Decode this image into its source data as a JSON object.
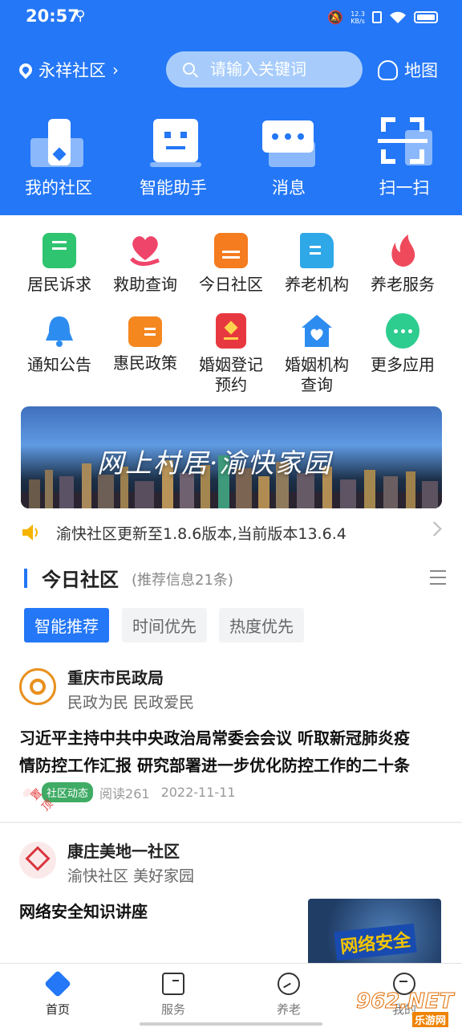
{
  "status": {
    "time": "20:57",
    "speed_value": "12.3",
    "speed_unit": "KB/s"
  },
  "topbar": {
    "location": "永祥社区",
    "search_placeholder": "请输入关键词",
    "map_label": "地图"
  },
  "quick_actions": [
    {
      "label": "我的社区",
      "icon": "community-icon"
    },
    {
      "label": "智能助手",
      "icon": "robot-icon"
    },
    {
      "label": "消息",
      "icon": "message-icon"
    },
    {
      "label": "扫一扫",
      "icon": "scan-icon"
    }
  ],
  "grid": [
    {
      "label": "居民诉求",
      "icon": "petition-icon",
      "color": "#2fc46f"
    },
    {
      "label": "救助查询",
      "icon": "heart-hand-icon",
      "color": "#f0456a"
    },
    {
      "label": "今日社区",
      "icon": "news-icon",
      "color": "#f57c1f"
    },
    {
      "label": "养老机构",
      "icon": "building-doc-icon",
      "color": "#2fa8e8"
    },
    {
      "label": "养老服务",
      "icon": "flame-icon",
      "color": "#ef4a5c"
    },
    {
      "label": "通知公告",
      "icon": "bell-icon",
      "color": "#2d8cf0"
    },
    {
      "label": "惠民政策",
      "icon": "policy-icon",
      "color": "#f5871f"
    },
    {
      "label": "婚姻登记",
      "label2": "预约",
      "icon": "marriage-book-icon",
      "color": "#e8383f"
    },
    {
      "label": "婚姻机构",
      "label2": "查询",
      "icon": "house-heart-icon",
      "color": "#2d8cf0"
    },
    {
      "label": "更多应用",
      "icon": "more-icon",
      "color": "#2dcc8f"
    }
  ],
  "banner": {
    "text": "网上村居·渝快家园"
  },
  "notice": {
    "text": "渝快社区更新至1.8.6版本,当前版本13.6.4"
  },
  "section": {
    "title": "今日社区",
    "subtitle": "(推荐信息21条)"
  },
  "filters": [
    "智能推荐",
    "时间优先",
    "热度优先"
  ],
  "posts": [
    {
      "author": "重庆市民政局",
      "slogan": "民政为民 民政爱民",
      "title_line1": "习近平主持中共中央政治局常委会会议 听取新冠肺炎疫",
      "title_line2": "情防控工作汇报 研究部署进一步优化防控工作的二十条",
      "tag_pin": "置顶",
      "tag_category": "社区动态",
      "reads": "阅读261",
      "date": "2022-11-11"
    },
    {
      "author": "康庄美地一社区",
      "slogan": "渝快社区 美好家园",
      "title_line1": "网络安全知识讲座",
      "thumb_text": "网络安全"
    }
  ],
  "tabs": [
    {
      "label": "首页",
      "icon": "home-icon",
      "active": true
    },
    {
      "label": "服务",
      "icon": "service-icon",
      "active": false
    },
    {
      "label": "养老",
      "icon": "elder-icon",
      "active": false
    },
    {
      "label": "我的",
      "icon": "profile-icon",
      "active": false
    }
  ],
  "watermark": {
    "big": "962.NET",
    "small": "乐游网"
  },
  "colors": {
    "primary": "#2477f6",
    "tag_green": "#3fab65",
    "tag_red": "#e63d3d"
  }
}
